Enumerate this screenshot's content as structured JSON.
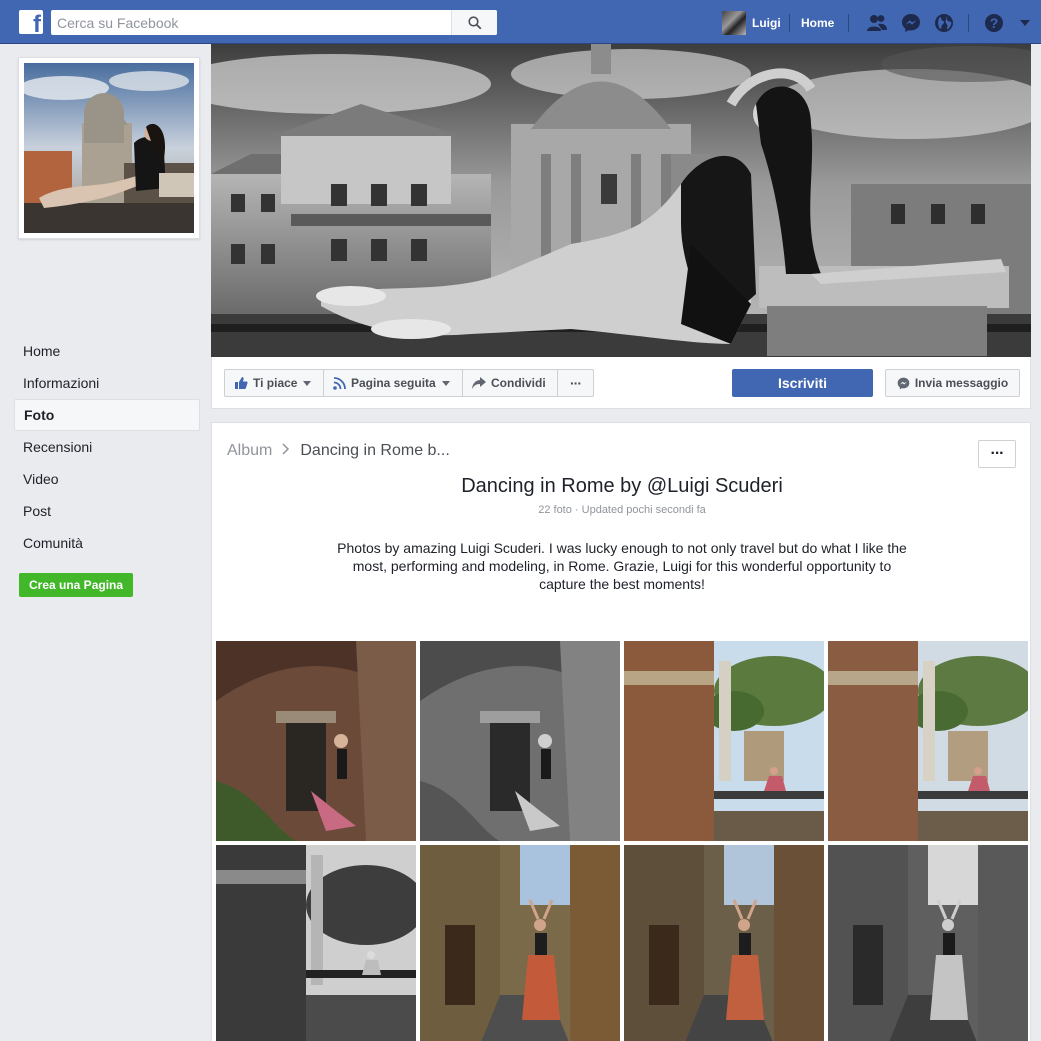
{
  "topbar": {
    "logo_letter": "f",
    "search_placeholder": "Cerca su Facebook",
    "user_name": "Luigi",
    "home_label": "Home"
  },
  "icons": {
    "search": "search-icon",
    "friends": "friends-icon",
    "messenger": "messenger-icon",
    "notifications": "globe-icon",
    "help": "help-icon",
    "menu": "chevron-down-icon"
  },
  "colors": {
    "brand": "#4267b2",
    "create_page": "#42b72a",
    "background": "#e9ebee"
  },
  "sidebar": {
    "items": [
      {
        "label": "Home",
        "active": false
      },
      {
        "label": "Informazioni",
        "active": false
      },
      {
        "label": "Foto",
        "active": true
      },
      {
        "label": "Recensioni",
        "active": false
      },
      {
        "label": "Video",
        "active": false
      },
      {
        "label": "Post",
        "active": false
      },
      {
        "label": "Comunità",
        "active": false
      }
    ],
    "create_page_label": "Crea una Pagina"
  },
  "actions": {
    "like_label": "Ti piace",
    "follow_label": "Pagina seguita",
    "share_label": "Condividi",
    "more_label": "···",
    "subscribe_label": "Iscriviti",
    "message_label": "Invia messaggio"
  },
  "album": {
    "breadcrumb_root": "Album",
    "breadcrumb_sep": ">",
    "breadcrumb_current": "Dancing in Rome b...",
    "more_label": "···",
    "title": "Dancing in Rome by @Luigi Scuderi",
    "meta": "22 foto · Updated pochi secondi fa",
    "description": "Photos by amazing Luigi Scuderi. I was lucky enough to not only travel but do what I like the most, performing and modeling, in Rome. Grazie, Luigi for this wonderful opportunity to capture the best moments!"
  }
}
